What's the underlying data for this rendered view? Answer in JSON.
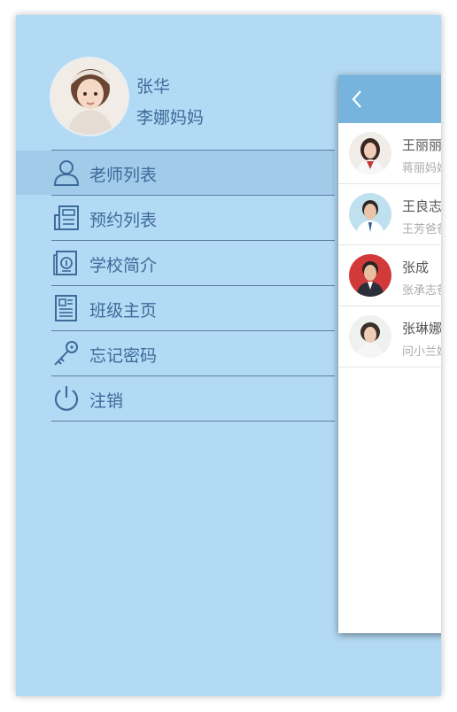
{
  "profile": {
    "name": "张华",
    "subtitle": "李娜妈妈"
  },
  "menu": {
    "items": [
      {
        "label": "老师列表",
        "icon": "person-icon",
        "active": true
      },
      {
        "label": "预约列表",
        "icon": "newspaper-icon",
        "active": false
      },
      {
        "label": "学校简介",
        "icon": "school-info-icon",
        "active": false
      },
      {
        "label": "班级主页",
        "icon": "document-icon",
        "active": false
      },
      {
        "label": "忘记密码",
        "icon": "key-icon",
        "active": false
      },
      {
        "label": "注销",
        "icon": "power-icon",
        "active": false
      }
    ]
  },
  "panel": {
    "back_icon": "chevron-left-icon",
    "contacts": [
      {
        "name": "王丽丽",
        "sub": "蒋丽妈妈"
      },
      {
        "name": "王良志",
        "sub": "王芳爸爸"
      },
      {
        "name": "张成",
        "sub": "张承志爸爸"
      },
      {
        "name": "张琳娜",
        "sub": "问小兰妈妈"
      }
    ]
  },
  "colors": {
    "drawer_bg": "#b3daf4",
    "active_bg": "#a1cbe9",
    "text": "#3d6b9a",
    "panel_header": "#76b4dd"
  }
}
